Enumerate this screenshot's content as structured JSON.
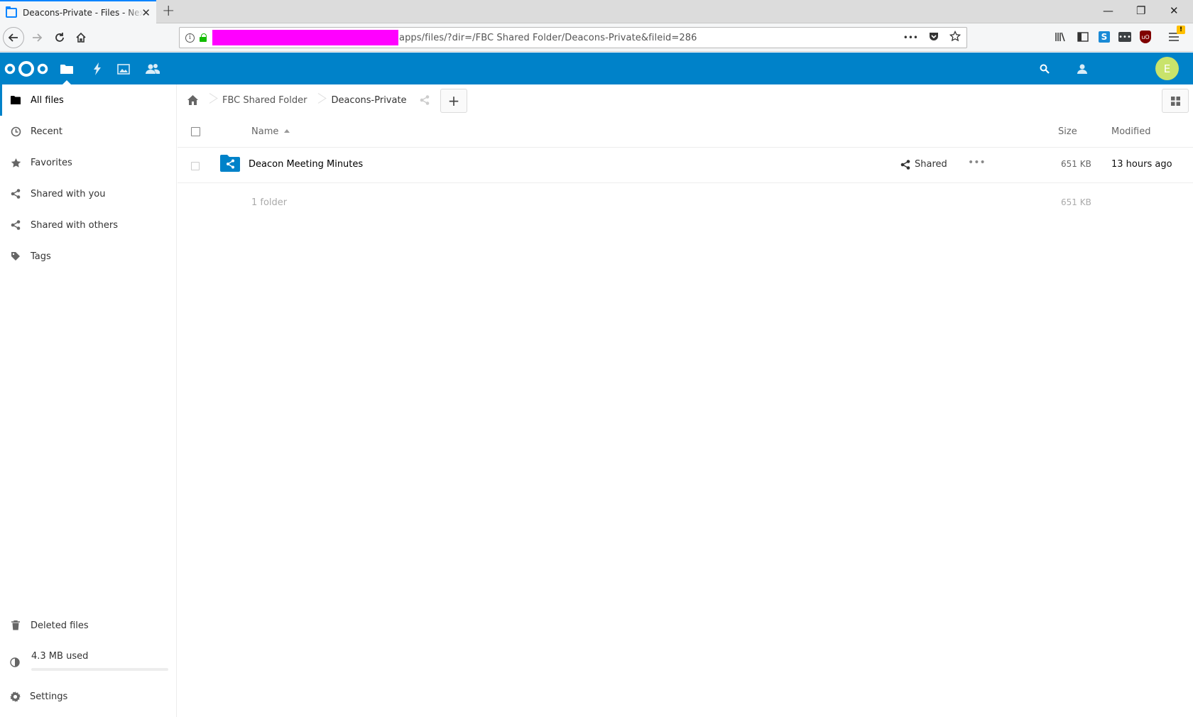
{
  "browser": {
    "tab_title": "Deacons-Private - Files - Nextcloud",
    "url_visible": "apps/files/?dir=/FBC Shared Folder/Deacons-Private&fileid=286",
    "win_minimize": "—",
    "win_restore": "❐",
    "win_close": "✕",
    "new_tab": "+",
    "tab_close": "✕",
    "url_more": "•••"
  },
  "header": {
    "avatar_letter": "E",
    "accent": "#0082c9"
  },
  "sidebar": {
    "items": [
      {
        "label": "All files",
        "icon": "folder-icon"
      },
      {
        "label": "Recent",
        "icon": "clock-icon"
      },
      {
        "label": "Favorites",
        "icon": "star-icon"
      },
      {
        "label": "Shared with you",
        "icon": "share-icon"
      },
      {
        "label": "Shared with others",
        "icon": "share-icon"
      },
      {
        "label": "Tags",
        "icon": "tag-icon"
      }
    ],
    "deleted": "Deleted files",
    "quota_text": "4.3 MB used",
    "quota_fraction": 0.0,
    "settings": "Settings"
  },
  "breadcrumb": {
    "items": [
      "FBC Shared Folder",
      "Deacons-Private"
    ],
    "add_label": "+"
  },
  "table": {
    "col_name": "Name",
    "col_size": "Size",
    "col_modified": "Modified",
    "rows": [
      {
        "name": "Deacon Meeting Minutes",
        "share_label": "Shared",
        "more": "•••",
        "size": "651 KB",
        "modified": "13 hours ago"
      }
    ],
    "summary_count": "1 folder",
    "summary_size": "651 KB"
  }
}
